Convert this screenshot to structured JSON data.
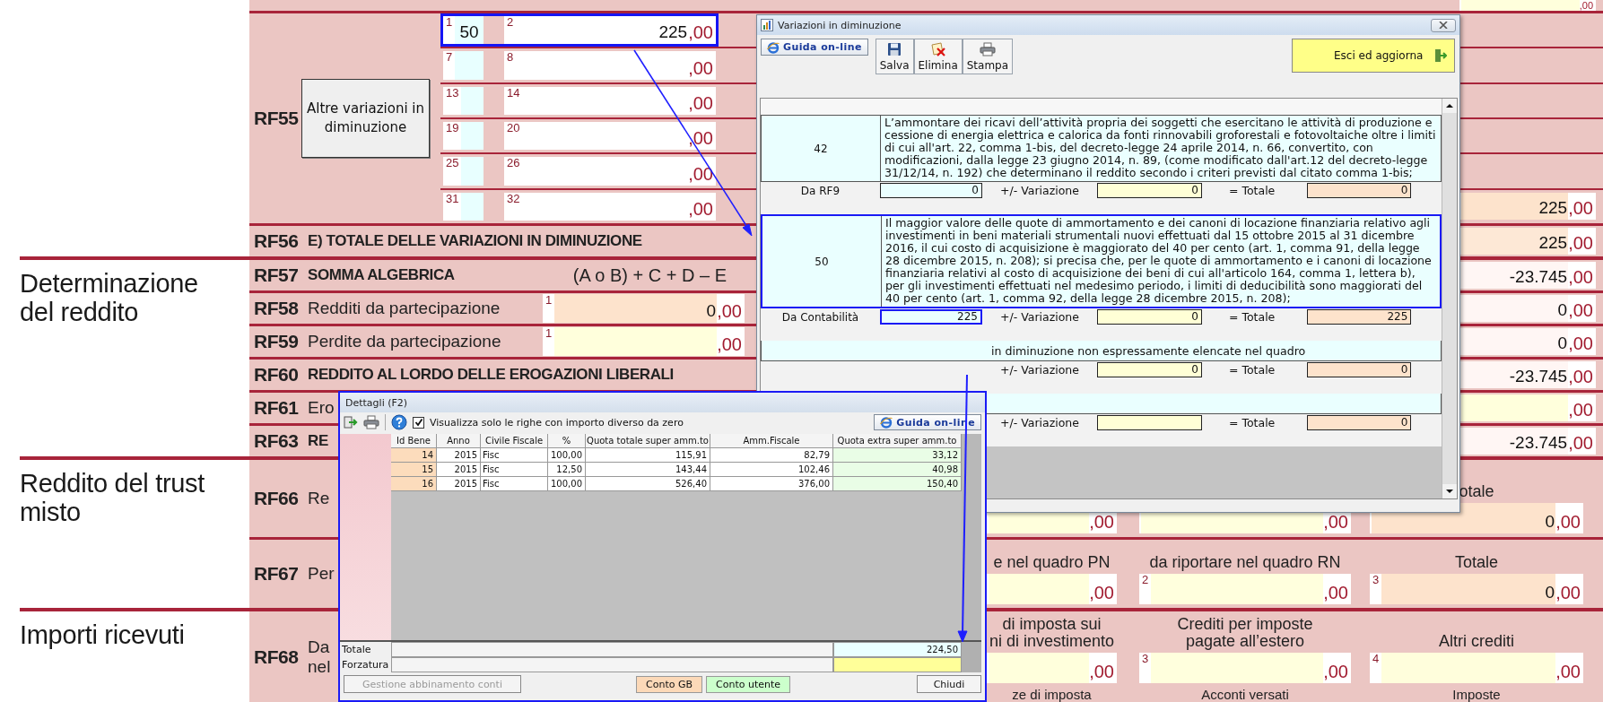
{
  "form": {
    "sections": [
      {
        "rows": [
          {
            "kind": "partial",
            "right": {
              "cents": ",00",
              "color": "#ffffdc"
            }
          },
          {
            "kind": "detail",
            "code": "RF55",
            "button": "Altre variazioni in diminuzione",
            "subrows": [
              {
                "number_a": "1",
                "value_a": "50",
                "number_b": "2",
                "amount": "225",
                "cents": ",00",
                "highlighted": true
              },
              {
                "number_a": "7",
                "number_b": "8",
                "cents": ",00",
                "highlighted": false
              },
              {
                "number_a": "13",
                "number_b": "14",
                "cents": ",00",
                "highlighted": false
              },
              {
                "number_a": "19",
                "number_b": "20",
                "cents": ",00",
                "highlighted": false
              },
              {
                "number_a": "25",
                "number_b": "26",
                "cents": ",00",
                "highlighted": false
              },
              {
                "number_a": "31",
                "number_b": "32",
                "cents": ",00",
                "highlighted": false,
                "total": {
                  "amount": "225",
                  "cents": ",00",
                  "color": "#fde3cc"
                }
              }
            ]
          },
          {
            "kind": "line",
            "code": "RF56",
            "label": "E) TOTALE DELLE VARIAZIONI IN DIMINUZIONE",
            "bold": true,
            "right": {
              "amount": "225",
              "cents": ",00",
              "color": "#fde8d6"
            }
          }
        ]
      },
      {
        "title": "Determinazione del reddito",
        "rows": [
          {
            "kind": "line",
            "code": "RF57",
            "label": "SOMMA ALGEBRICA",
            "bold": true,
            "formula": "(A o B) + C + D – E",
            "right": {
              "amount": "-23.745",
              "cents": ",00",
              "color": "#fff6f4"
            }
          },
          {
            "kind": "line",
            "code": "RF58",
            "label": "Redditi da partecipazione",
            "bold": false,
            "field": {
              "number": "1",
              "amount": "0",
              "cents": ",00",
              "color": "#fde3cc"
            },
            "right": {
              "amount": "0",
              "cents": ",00",
              "color": "#fff6f4"
            }
          },
          {
            "kind": "line",
            "code": "RF59",
            "label": "Perdite da partecipazione",
            "bold": false,
            "field": {
              "number": "1",
              "cents": ",00",
              "color": "#ffffdc"
            },
            "right": {
              "amount": "0",
              "cents": ",00",
              "color": "#fff6f4"
            }
          },
          {
            "kind": "line",
            "code": "RF60",
            "label": "REDDITO AL LORDO DELLE EROGAZIONI LIBERALI",
            "bold": true,
            "right": {
              "amount": "-23.745",
              "cents": ",00",
              "color": "#fff6f4"
            }
          },
          {
            "kind": "line",
            "code": "RF61",
            "label": "Ero",
            "bold": false,
            "right": {
              "cents": ",00",
              "color": "#ffffdc"
            }
          },
          {
            "kind": "line",
            "code": "RF63",
            "label": "RE",
            "bold": true,
            "right": {
              "amount": "-23.745",
              "cents": ",00",
              "color": "#fff6f4"
            }
          }
        ]
      },
      {
        "title": "Reddito del trust misto",
        "rows": [
          {
            "kind": "columns",
            "code": "RF66",
            "label_lines": [
              "Re"
            ],
            "columns": [
              {
                "cents": ",00",
                "color": "#ffffdc"
              },
              {
                "cents": ",00",
                "color": "#ffffdd"
              },
              {
                "heading": [
                  "otale"
                ],
                "amount": "0",
                "cents": ",00",
                "color": "#fde3cc"
              }
            ]
          },
          {
            "kind": "columns",
            "code": "RF67",
            "label_lines": [
              "Per"
            ],
            "columns": [
              {
                "heading": [
                  "e nel quadro PN"
                ],
                "cents": ",00",
                "color": "#ffffdc"
              },
              {
                "heading": [
                  "da riportare nel quadro RN"
                ],
                "number": "2",
                "cents": ",00",
                "color": "#ffffdd"
              },
              {
                "heading": [
                  "Totale"
                ],
                "number": "3",
                "amount": "0",
                "cents": ",00",
                "color": "#fde3cc"
              }
            ]
          }
        ]
      },
      {
        "title": "Importi ricevuti",
        "rows": [
          {
            "kind": "columns",
            "code": "RF68",
            "label_lines": [
              "Da",
              "nel"
            ],
            "columns": [
              {
                "heading": [
                  "di imposta sui",
                  "ni di investimento"
                ],
                "cents": ",00",
                "color": "#ffffdc",
                "footer": "ze di imposta"
              },
              {
                "heading": [
                  "Crediti per imposte",
                  "pagate all’estero"
                ],
                "number": "3",
                "cents": ",00",
                "color": "#ffffdd",
                "footer": "Acconti versati"
              },
              {
                "heading": [
                  "Altri crediti"
                ],
                "number": "4",
                "cents": ",00",
                "color": "#fffedc",
                "footer": "Imposte"
              }
            ]
          }
        ]
      }
    ]
  },
  "variazioni_window": {
    "title": "Variazioni in diminuzione",
    "help_button": "Guida on-line",
    "tools": [
      {
        "kind": "save",
        "label": "Salva"
      },
      {
        "kind": "delete",
        "label": "Elimina"
      },
      {
        "kind": "print",
        "label": "Stampa"
      }
    ],
    "exit_button": "Esci ed aggiorna",
    "entries": [
      {
        "kind": "full",
        "code": "42",
        "text": "L’ammontare dei ricavi dell’attività propria dei soggetti che esercitano le attività di produzione e cessione di energia elettrica e calorica da fonti rinnovabili groforestali e fotovoltaiche oltre i limiti di cui all'art. 22, comma 1-bis, del decreto-legge 24 aprile 2014, n. 66, convertito, con modificazioni, dalla legge 23 giugno 2014, n. 89, (come modificato dall'art.12 del decreto-legge 31/12/14, n. 192) che determinano il reddito secondo i criteri previsti dal citato comma 1-bis;",
        "highlighted": false,
        "source_label": "Da RF9",
        "source_value": "0",
        "source_highlighted": false,
        "change_label": "+/- Variazione",
        "change_value": "0",
        "total_label": "= Totale",
        "total_value": "0"
      },
      {
        "kind": "full",
        "code": "50",
        "text": "Il maggior valore delle quote di ammortamento e dei canoni di locazione finanziaria relativo agli investimenti in beni materiali strumentali nuovi effettuati dal 15 ottobre 2015 al 31 dicembre 2016, il cui costo di acquisizione è maggiorato del 40 per cento (art. 1, comma 91, della legge 28 dicembre 2015, n. 208); si precisa che, per le quote di ammortamento e i canoni di locazione finanziaria relativi al costo di acquisizione dei beni di cui all'articolo 164, comma 1, lettera b), per gli investimenti effettuati nel medesimo periodo, i limiti di deducibilità sono maggiorati del 40 per cento (art. 1, comma 92, della legge 28 dicembre 2015, n. 208);",
        "highlighted": true,
        "source_label": "Da Contabilità",
        "source_value": "225",
        "source_highlighted": true,
        "change_label": "+/- Variazione",
        "change_value": "0",
        "total_label": "= Totale",
        "total_value": "225"
      },
      {
        "kind": "covered",
        "text": "in diminuzione non espressamente elencate nel quadro",
        "highlighted": false,
        "change_label": "+/- Variazione",
        "change_value": "0",
        "total_label": "= Totale",
        "total_value": "0"
      },
      {
        "kind": "covered",
        "highlighted": false,
        "change_label": "+/- Variazione",
        "total_label": "= Totale",
        "total_value": "0"
      }
    ]
  },
  "dettagli_window": {
    "title": "Dettagli (F2)",
    "filter_checked": true,
    "filter_label": "Visualizza solo le righe con importo diverso da zero",
    "help_button": "Guida on-line",
    "columns": [
      "Id Bene",
      "Anno",
      "Civile Fiscale",
      "%",
      "Quota totale super amm.to",
      "Amm.Fiscale",
      "Quota extra super amm.to"
    ],
    "rows": [
      [
        "14",
        "2015",
        "Fisc",
        "100,00",
        "115,91",
        "82,79",
        "33,12"
      ],
      [
        "15",
        "2015",
        "Fisc",
        "12,50",
        "143,44",
        "102,46",
        "40,98"
      ],
      [
        "16",
        "2015",
        "Fisc",
        "100,00",
        "526,40",
        "376,00",
        "150,40"
      ]
    ],
    "total_label": "Totale",
    "total_value": "224,50",
    "override_label": "Forzatura",
    "accounts_button": {
      "label": "Gestione abbinamento conti",
      "disabled": true
    },
    "legend": [
      {
        "label": "Conto GB",
        "color": "#fcd9b8"
      },
      {
        "label": "Conto utente",
        "color": "#ccffcc"
      }
    ],
    "close_button": "Chiudi"
  }
}
